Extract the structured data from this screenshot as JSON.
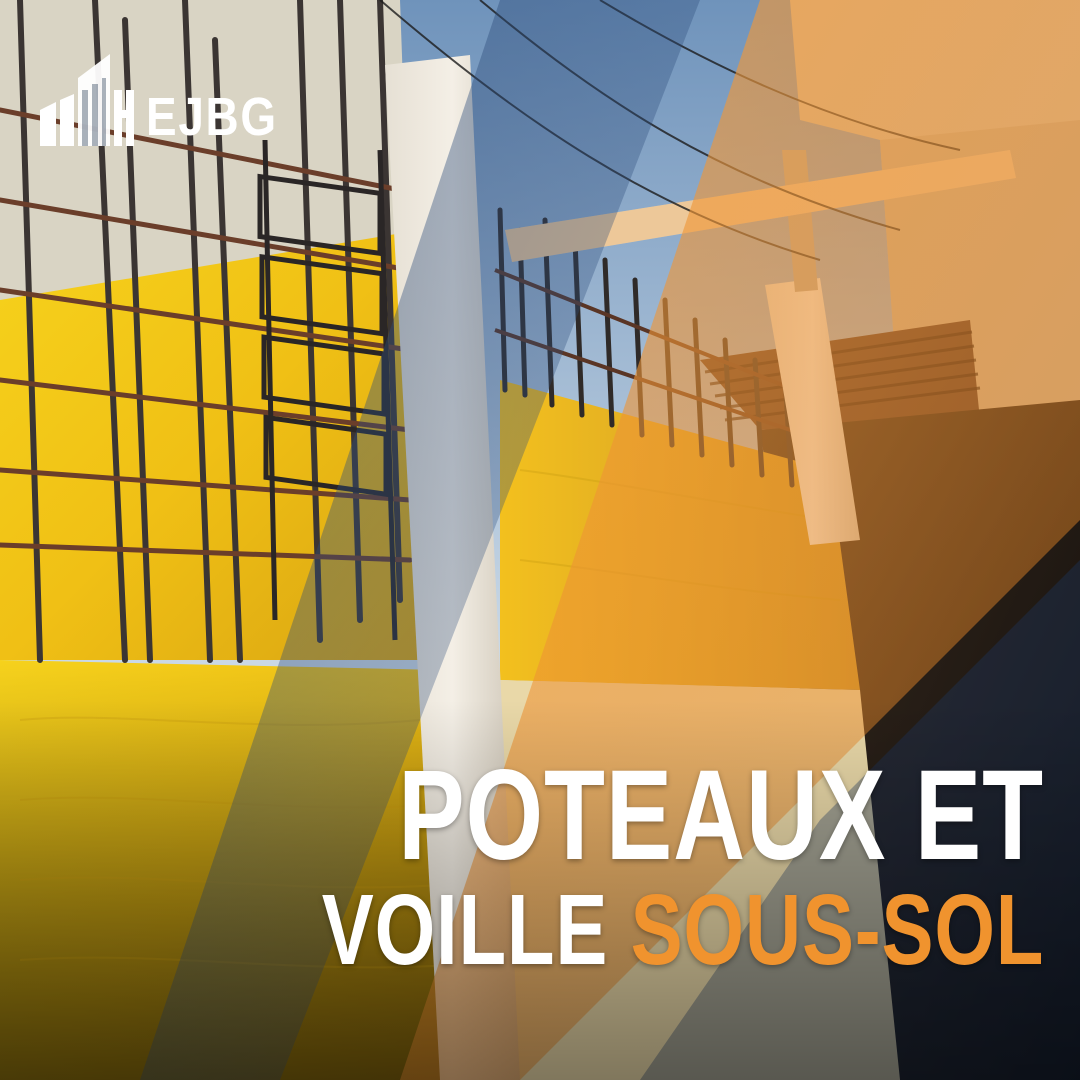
{
  "brand": {
    "name": "EJBG",
    "logo_icon": "building-logo-icon"
  },
  "headline": {
    "line1": "POTEAUX ET",
    "line2_white": "VOILLE",
    "line2_orange": "SOUS-SOL"
  },
  "colors": {
    "accent_orange": "#f0932e",
    "formwork_yellow": "#f2c21a",
    "sky_blue": "#8fb3d6",
    "text_white": "#ffffff"
  }
}
